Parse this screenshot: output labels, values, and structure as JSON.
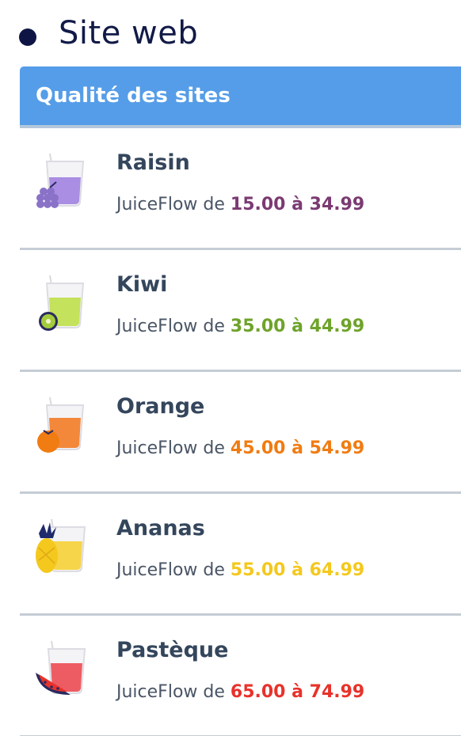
{
  "section": {
    "title": "Site web"
  },
  "panel": {
    "header": "Qualité des sites"
  },
  "rows": [
    {
      "name": "Raisin",
      "prefix": "JuiceFlow de",
      "range": "15.00 à 34.99",
      "color": "#7b3a72",
      "juice_color": "#a98ee3",
      "icon": "grape-juice-icon"
    },
    {
      "name": "Kiwi",
      "prefix": "JuiceFlow de",
      "range": "35.00 à 44.99",
      "color": "#6ea32a",
      "juice_color": "#c4e25b",
      "icon": "kiwi-juice-icon"
    },
    {
      "name": "Orange",
      "prefix": "JuiceFlow de",
      "range": "45.00 à 54.99",
      "color": "#f07c12",
      "juice_color": "#f3883a",
      "icon": "orange-juice-icon"
    },
    {
      "name": "Ananas",
      "prefix": "JuiceFlow de",
      "range": "55.00 à 64.99",
      "color": "#f4c81d",
      "juice_color": "#f6d54a",
      "icon": "pineapple-juice-icon"
    },
    {
      "name": "Pastèque",
      "prefix": "JuiceFlow de",
      "range": "65.00 à 74.99",
      "color": "#e8322a",
      "juice_color": "#ee5c63",
      "icon": "watermelon-juice-icon"
    }
  ]
}
